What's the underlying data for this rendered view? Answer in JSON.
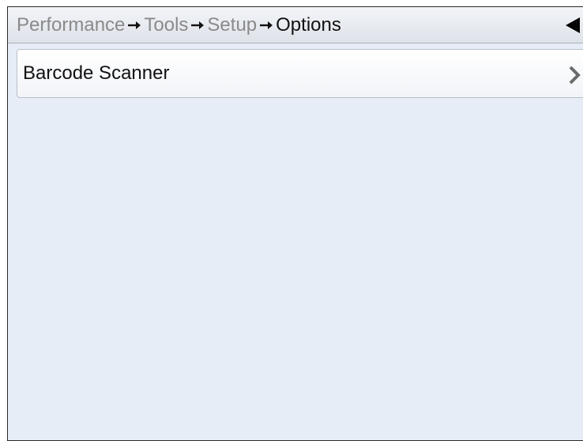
{
  "header": {
    "breadcrumb": [
      {
        "label": "Performance",
        "current": false
      },
      {
        "label": "Tools",
        "current": false
      },
      {
        "label": "Setup",
        "current": false
      },
      {
        "label": "Options",
        "current": true
      }
    ],
    "separator_icon": "arrow-right-icon",
    "back_icon": "back-triangle-icon"
  },
  "list": {
    "items": [
      {
        "label": "Barcode Scanner",
        "icon": "chevron-right-icon"
      }
    ]
  },
  "colors": {
    "background": "#e6edf6",
    "breadcrumb_inactive": "#8a8a8a",
    "breadcrumb_active": "#111111"
  }
}
